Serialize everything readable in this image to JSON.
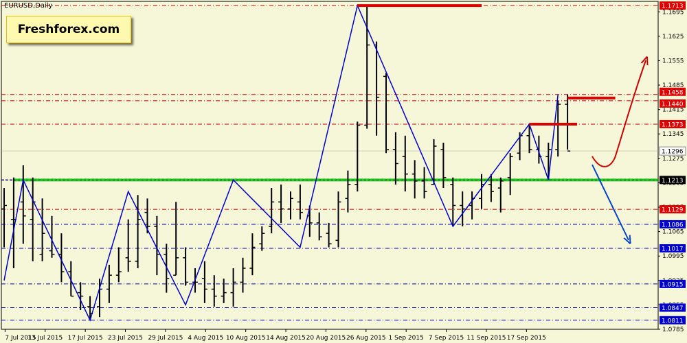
{
  "window": {
    "symbol_title": "EURUSD,Daily"
  },
  "brand": {
    "text": "Freshforex.com"
  },
  "colors": {
    "background": "#f6f6d8",
    "candles": "#000000",
    "zigzag": "#0000cc",
    "resistance": "#dd0000",
    "support": "#22cc22",
    "level_dashed_red": "#cc0000",
    "level_dashed_blue": "#0000aa",
    "arrow_up": "#cc0000",
    "arrow_down": "#0044cc",
    "price_badge_red": "#dd0000",
    "price_badge_blue": "#0000cc"
  },
  "chart_data": {
    "type": "ohlc",
    "title": "EURUSD,Daily",
    "ylim": [
      1.0785,
      1.1725
    ],
    "y_ticks": [
      "1.1695",
      "1.1625",
      "1.1555",
      "1.1485",
      "1.1415",
      "1.1345",
      "1.1275",
      "1.1205",
      "1.1135",
      "1.1065",
      "1.0995",
      "1.0925",
      "1.0855",
      "1.0785"
    ],
    "x_ticks": [
      "7 Jul 2015",
      "13 Jul 2015",
      "17 Jul 2015",
      "23 Jul 2015",
      "29 Jul 2015",
      "4 Aug 2015",
      "10 Aug 2015",
      "14 Aug 2015",
      "20 Aug 2015",
      "26 Aug 2015",
      "1 Sep 2015",
      "7 Sep 2015",
      "11 Sep 2015",
      "17 Sep 2015"
    ],
    "bars": [
      [
        1.113,
        1.119,
        1.102,
        1.114
      ],
      [
        1.11,
        1.122,
        1.096,
        1.11
      ],
      [
        1.115,
        1.1255,
        1.103,
        1.111
      ],
      [
        1.11,
        1.122,
        1.098,
        1.115
      ],
      [
        1.1,
        1.116,
        1.098,
        1.106
      ],
      [
        1.101,
        1.111,
        1.099,
        1.1
      ],
      [
        1.1,
        1.106,
        1.092,
        1.095
      ],
      [
        1.095,
        1.098,
        1.088,
        1.088
      ],
      [
        1.089,
        1.092,
        1.084,
        1.088
      ],
      [
        1.085,
        1.088,
        1.081,
        1.083
      ],
      [
        1.085,
        1.093,
        1.082,
        1.09
      ],
      [
        1.09,
        1.097,
        1.086,
        1.094
      ],
      [
        1.094,
        1.102,
        1.092,
        1.095
      ],
      [
        1.099,
        1.11,
        1.095,
        1.098
      ],
      [
        1.098,
        1.117,
        1.096,
        1.11
      ],
      [
        1.112,
        1.116,
        1.106,
        1.108
      ],
      [
        1.108,
        1.111,
        1.094,
        1.1
      ],
      [
        1.1,
        1.103,
        1.089,
        1.093
      ],
      [
        1.094,
        1.115,
        1.094,
        1.099
      ],
      [
        1.099,
        1.102,
        1.091,
        1.092
      ],
      [
        1.092,
        1.096,
        1.089,
        1.092
      ],
      [
        1.093,
        1.098,
        1.086,
        1.09
      ],
      [
        1.09,
        1.094,
        1.085,
        1.088
      ],
      [
        1.088,
        1.093,
        1.086,
        1.089
      ],
      [
        1.089,
        1.096,
        1.085,
        1.092
      ],
      [
        1.092,
        1.099,
        1.089,
        1.096
      ],
      [
        1.096,
        1.106,
        1.094,
        1.102
      ],
      [
        1.103,
        1.108,
        1.101,
        1.106
      ],
      [
        1.108,
        1.119,
        1.106,
        1.115
      ],
      [
        1.115,
        1.12,
        1.109,
        1.113
      ],
      [
        1.113,
        1.118,
        1.11,
        1.116
      ],
      [
        1.115,
        1.12,
        1.11,
        1.112
      ],
      [
        1.111,
        1.114,
        1.105,
        1.109
      ],
      [
        1.109,
        1.112,
        1.104,
        1.105
      ],
      [
        1.106,
        1.109,
        1.102,
        1.103
      ],
      [
        1.104,
        1.118,
        1.102,
        1.115
      ],
      [
        1.116,
        1.124,
        1.112,
        1.12
      ],
      [
        1.12,
        1.138,
        1.118,
        1.137
      ],
      [
        1.137,
        1.1713,
        1.136,
        1.16
      ],
      [
        1.16,
        1.161,
        1.134,
        1.145
      ],
      [
        1.151,
        1.152,
        1.129,
        1.13
      ],
      [
        1.13,
        1.135,
        1.12,
        1.126
      ],
      [
        1.128,
        1.134,
        1.118,
        1.123
      ],
      [
        1.123,
        1.127,
        1.116,
        1.121
      ],
      [
        1.121,
        1.125,
        1.116,
        1.118
      ],
      [
        1.12,
        1.133,
        1.12,
        1.131
      ],
      [
        1.13,
        1.132,
        1.119,
        1.122
      ],
      [
        1.12,
        1.122,
        1.108,
        1.114
      ],
      [
        1.114,
        1.118,
        1.108,
        1.113
      ],
      [
        1.114,
        1.118,
        1.11,
        1.116
      ],
      [
        1.116,
        1.123,
        1.113,
        1.12
      ],
      [
        1.12,
        1.123,
        1.115,
        1.118
      ],
      [
        1.119,
        1.122,
        1.112,
        1.121
      ],
      [
        1.122,
        1.129,
        1.117,
        1.128
      ],
      [
        1.129,
        1.135,
        1.127,
        1.134
      ],
      [
        1.134,
        1.1373,
        1.129,
        1.13
      ],
      [
        1.13,
        1.134,
        1.126,
        1.128
      ],
      [
        1.128,
        1.132,
        1.1213,
        1.13
      ],
      [
        1.13,
        1.144,
        1.128,
        1.143
      ],
      [
        1.143,
        1.1458,
        1.13,
        1.1296
      ]
    ],
    "zigzag": [
      {
        "i": 0,
        "p": 1.0925
      },
      {
        "i": 2,
        "p": 1.1213
      },
      {
        "i": 9,
        "p": 1.0811
      },
      {
        "i": 13,
        "p": 1.118
      },
      {
        "i": 19,
        "p": 1.0855
      },
      {
        "i": 24,
        "p": 1.1213
      },
      {
        "i": 31,
        "p": 1.102
      },
      {
        "i": 37,
        "p": 1.1713
      },
      {
        "i": 47,
        "p": 1.108
      },
      {
        "i": 55,
        "p": 1.1373
      },
      {
        "i": 57,
        "p": 1.1213
      },
      {
        "i": 58,
        "p": 1.1458
      }
    ],
    "resistance_segments": [
      {
        "price": 1.1713,
        "from_bar": 37,
        "to_bar": 50
      },
      {
        "price": 1.1373,
        "from_bar": 55,
        "to_bar": 60
      },
      {
        "price": 1.1448,
        "from_bar": 59,
        "to_bar": 64
      }
    ],
    "support_line": {
      "price": 1.1213,
      "from_bar": 1
    },
    "levels": [
      {
        "price": 1.1713,
        "label": "1.1713",
        "style": "red-dashed"
      },
      {
        "price": 1.1458,
        "label": "1.1458",
        "style": "red-dashed"
      },
      {
        "price": 1.144,
        "label": "1.1440",
        "style": "red-dashed"
      },
      {
        "price": 1.1373,
        "label": "1.1373",
        "style": "red-dashed"
      },
      {
        "price": 1.1296,
        "label": "1.1296",
        "style": "current"
      },
      {
        "price": 1.1213,
        "label": "1.1213",
        "style": "support"
      },
      {
        "price": 1.1129,
        "label": "1.1129",
        "style": "red-dashed"
      },
      {
        "price": 1.1086,
        "label": "1.1086",
        "style": "blue-dashed"
      },
      {
        "price": 1.1017,
        "label": "1.1017",
        "style": "blue-dashed"
      },
      {
        "price": 1.0915,
        "label": "1.0915",
        "style": "blue-dashed"
      },
      {
        "price": 1.0847,
        "label": "1.0847",
        "style": "blue-dashed"
      },
      {
        "price": 1.0811,
        "label": "1.0811",
        "style": "blue-dashed"
      }
    ]
  }
}
